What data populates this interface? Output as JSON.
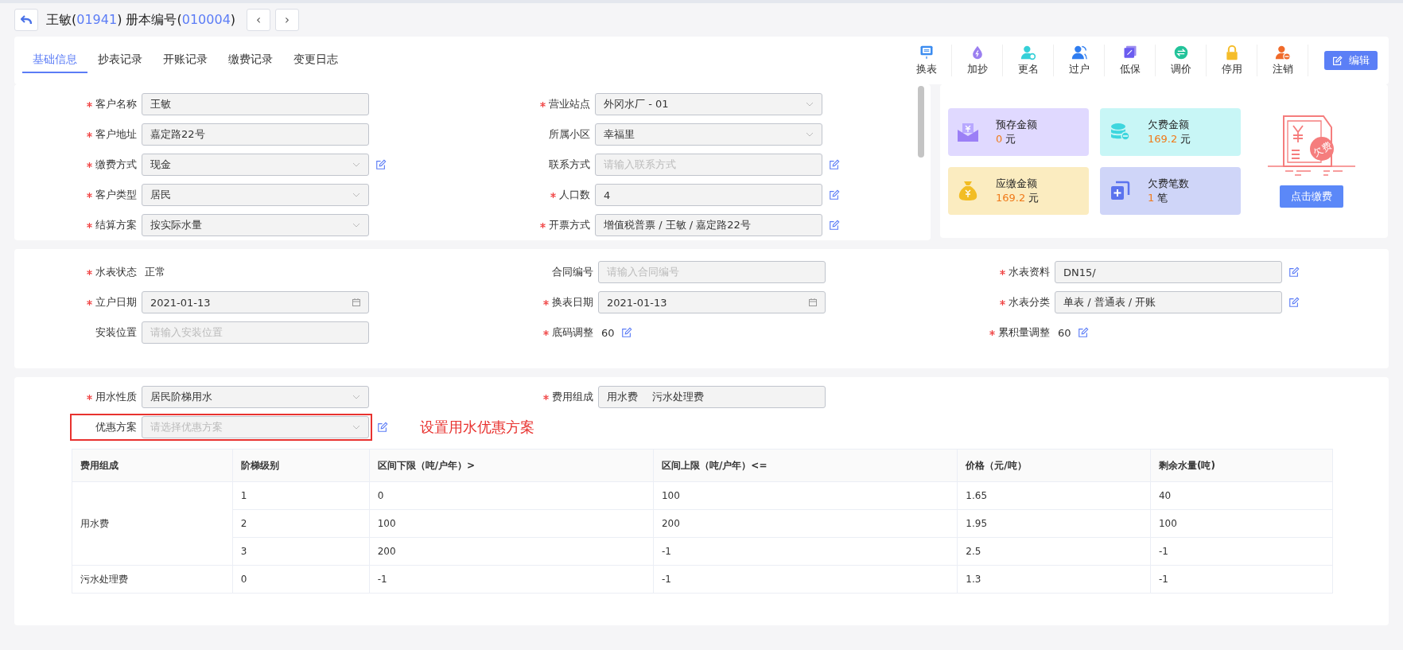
{
  "header": {
    "title_parts": [
      {
        "text": "王敏(",
        "kind": "plain"
      },
      {
        "text": "01941",
        "kind": "accent"
      },
      {
        "text": ") 册本编号(",
        "kind": "plain"
      },
      {
        "text": "010004",
        "kind": "accent"
      },
      {
        "text": ")",
        "kind": "plain"
      }
    ],
    "prev": "‹",
    "next": "›"
  },
  "tabs": [
    {
      "label": "基础信息",
      "selected": true
    },
    {
      "label": "抄表记录",
      "selected": false
    },
    {
      "label": "开账记录",
      "selected": false
    },
    {
      "label": "缴费记录",
      "selected": false
    },
    {
      "label": "变更日志",
      "selected": false
    }
  ],
  "toolbar": [
    {
      "label": "换表",
      "kind": "meter"
    },
    {
      "label": "加抄",
      "kind": "drop"
    },
    {
      "label": "更名",
      "kind": "user-gear"
    },
    {
      "label": "过户",
      "kind": "users"
    },
    {
      "label": "低保",
      "kind": "note"
    },
    {
      "label": "调价",
      "kind": "exchange"
    },
    {
      "label": "停用",
      "kind": "lock"
    },
    {
      "label": "注销",
      "kind": "user-minus"
    }
  ],
  "edit_button": "编辑",
  "customer_form": {
    "fields": [
      {
        "label": "客户名称",
        "required": true,
        "kind": "text",
        "value": "王敏",
        "editable": false
      },
      {
        "label": "营业站点",
        "required": true,
        "kind": "select",
        "value": "外冈水厂 - 01",
        "editable": false
      },
      {
        "label": "客户地址",
        "required": true,
        "kind": "text",
        "value": "嘉定路22号",
        "editable": false
      },
      {
        "label": "所属小区",
        "required": false,
        "kind": "select",
        "value": "幸福里",
        "editable": false
      },
      {
        "label": "缴费方式",
        "required": true,
        "kind": "select",
        "value": "现金",
        "editable": true
      },
      {
        "label": "联系方式",
        "required": false,
        "kind": "text",
        "placeholder": "请输入联系方式",
        "editable": true
      },
      {
        "label": "客户类型",
        "required": true,
        "kind": "select",
        "value": "居民",
        "editable": false
      },
      {
        "label": "人口数",
        "required": true,
        "kind": "text",
        "value": "4",
        "editable": true
      },
      {
        "label": "结算方案",
        "required": true,
        "kind": "select",
        "value": "按实际水量",
        "editable": false
      },
      {
        "label": "开票方式",
        "required": true,
        "kind": "text",
        "value": "增值税普票 / 王敏 / 嘉定路22号",
        "editable": true
      }
    ]
  },
  "summary": {
    "cards": [
      {
        "label": "预存金额",
        "amount": "0",
        "unit": "元",
        "color": "#e0d9ff",
        "kind": "envelope"
      },
      {
        "label": "欠费金额",
        "amount": "169.2",
        "unit": "元",
        "color": "#c8f6f6",
        "kind": "coins"
      },
      {
        "label": "应缴金额",
        "amount": "169.2",
        "unit": "元",
        "color": "#fbecc0",
        "kind": "bag"
      },
      {
        "label": "欠费笔数",
        "amount": "1",
        "unit": "笔",
        "color": "#cfd5f8",
        "kind": "copy"
      }
    ],
    "stamp": "欠费",
    "pay_button": "点击缴费"
  },
  "meter_form": {
    "fields": [
      {
        "label": "水表状态",
        "required": true,
        "kind": "static",
        "value": "正常",
        "editable": false
      },
      {
        "label": "合同编号",
        "required": false,
        "kind": "text",
        "placeholder": "请输入合同编号",
        "editable": false
      },
      {
        "label": "水表资料",
        "required": true,
        "kind": "text",
        "value": "DN15/",
        "editable": true
      },
      {
        "label": "立户日期",
        "required": true,
        "kind": "date",
        "value": "2021-01-13",
        "editable": false
      },
      {
        "label": "换表日期",
        "required": true,
        "kind": "date",
        "value": "2021-01-13",
        "editable": false
      },
      {
        "label": "水表分类",
        "required": true,
        "kind": "text",
        "value": "单表 / 普通表 / 开账",
        "editable": true
      },
      {
        "label": "安装位置",
        "required": false,
        "kind": "text",
        "placeholder": "请输入安装位置",
        "editable": false
      },
      {
        "label": "底码调整",
        "required": true,
        "kind": "static",
        "value": "60",
        "editable": true
      },
      {
        "label": "累积量调整",
        "required": true,
        "kind": "static",
        "value": "60",
        "editable": true
      }
    ]
  },
  "usage_form": {
    "fields": [
      {
        "label": "用水性质",
        "required": true,
        "kind": "select",
        "value": "居民阶梯用水",
        "editable": false,
        "highlighted": false
      },
      {
        "label": "费用组成",
        "required": true,
        "kind": "tags",
        "tags": [
          "用水费",
          "污水处理费"
        ],
        "editable": false,
        "highlighted": false
      },
      {
        "label": "优惠方案",
        "required": false,
        "kind": "select",
        "placeholder": "请选择优惠方案",
        "editable": true,
        "highlighted": true,
        "annotation": "设置用水优惠方案"
      }
    ],
    "table": {
      "columns": [
        "费用组成",
        "阶梯级别",
        "区间下限（吨/户年）>",
        "区间上限（吨/户年）<=",
        "价格（元/吨）",
        "剩余水量(吨)"
      ],
      "groups": [
        {
          "name": "用水费",
          "rows": [
            [
              "1",
              "0",
              "100",
              "1.65",
              "40"
            ],
            [
              "2",
              "100",
              "200",
              "1.95",
              "100"
            ],
            [
              "3",
              "200",
              "-1",
              "2.5",
              "-1"
            ]
          ]
        },
        {
          "name": "污水处理费",
          "rows": [
            [
              "0",
              "-1",
              "-1",
              "1.3",
              "-1"
            ]
          ]
        }
      ]
    }
  }
}
